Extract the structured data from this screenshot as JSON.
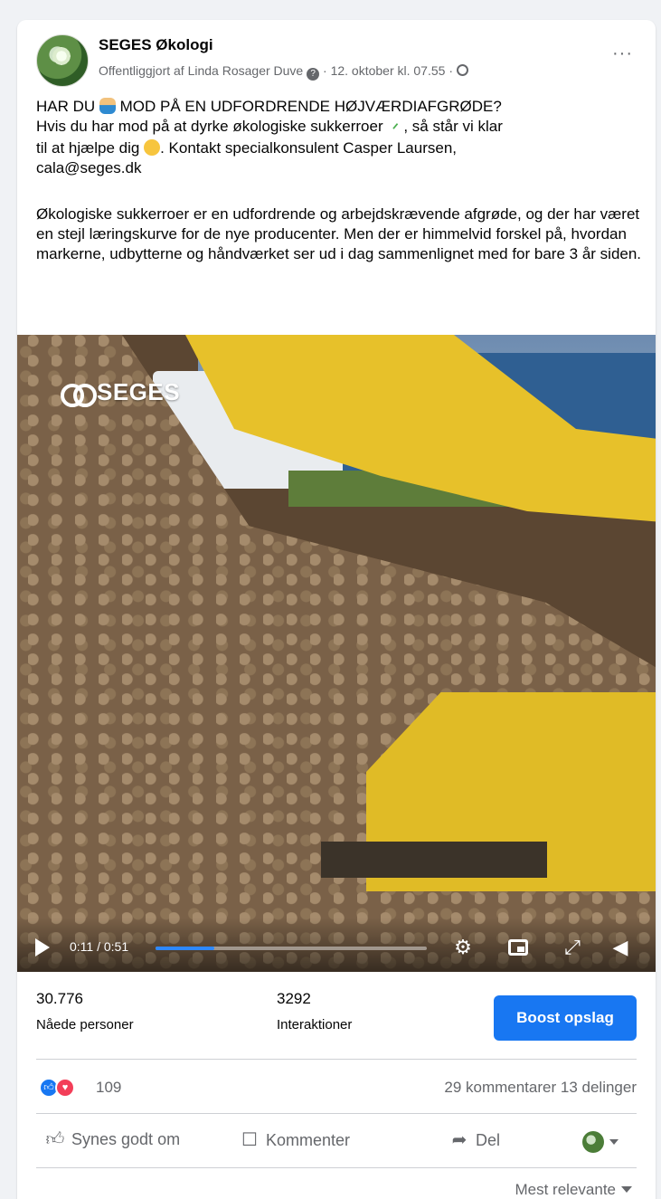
{
  "post": {
    "page_name": "SEGES Økologi",
    "published_by": "Offentliggjort af Linda Rosager Duve",
    "date": "12. oktober kl. 07.55",
    "more_label": "···",
    "text": {
      "p1_line1_a": "HAR DU ",
      "p1_line1_b": " MOD PÅ EN UDFORDRENDE HØJVÆRDIAFGRØDE?",
      "p1_line2_a": "Hvis du har mod på at dyrke økologiske sukkerroer ",
      "p1_line2_b": ", så står vi klar",
      "p1_line3_a": "til at hjælpe dig ",
      "p1_line3_b": ". Kontakt specialkonsulent Casper Laursen,",
      "p1_line4": "cala@seges.dk",
      "p2": "Økologiske sukkerroer er en udfordrende og arbejdskrævende afgrøde, og der har været en stejl læringskurve for de nye producenter. Men der er himmelvid forskel på, hvordan markerne, udbytterne og håndværket ser ud i dag sammenlignet med for bare 3 år siden."
    },
    "icons": {
      "emoji1": "person-emoji",
      "emoji2": "seedling-emoji",
      "emoji3": "smiling-face-emoji"
    }
  },
  "video": {
    "watermark": "SEGES",
    "time": "0:11 / 0:51",
    "progress_fraction": 0.216,
    "accent_color": "#2d88ff"
  },
  "stats": {
    "reached_value": "30.776",
    "reached_label": "Nåede personer",
    "interactions_value": "3292",
    "interactions_label": "Interaktioner",
    "boost_label": "Boost opslag"
  },
  "engagement": {
    "reaction_count": "109",
    "comments": "29 kommentarer",
    "shares": "13 delinger"
  },
  "actions": {
    "like": "Synes godt om",
    "comment": "Kommenter",
    "share": "Del"
  },
  "sort": {
    "label": "Mest relevante"
  },
  "colors": {
    "brand_blue": "#1877f2",
    "text_secondary": "#65676b"
  }
}
